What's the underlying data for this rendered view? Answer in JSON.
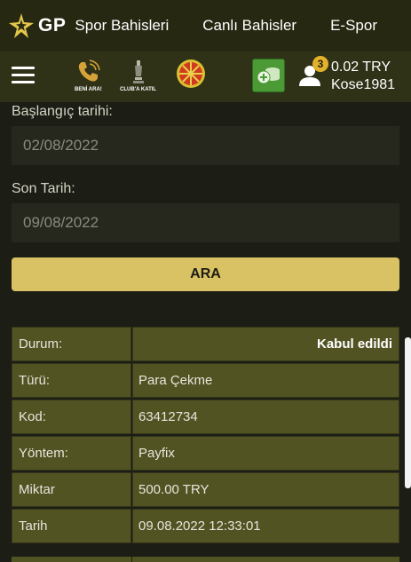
{
  "header": {
    "logo_text": "GP",
    "nav": [
      "Spor Bahisleri",
      "Canlı Bahisler",
      "E-Spor"
    ]
  },
  "toolbar": {
    "promos": [
      {
        "label": "BENİ ARA!",
        "icon": "phone-icon"
      },
      {
        "label": "CLUB'A KATIL",
        "icon": "trophy-icon"
      },
      {
        "label": "",
        "icon": "wheel-icon"
      }
    ],
    "notification_count": "3",
    "balance": "0.02 TRY",
    "username": "Kose1981"
  },
  "filters": {
    "start_label": "Başlangıç tarihi:",
    "start_value": "02/08/2022",
    "end_label": "Son Tarih:",
    "end_value": "09/08/2022",
    "search_label": "ARA"
  },
  "details": [
    {
      "key": "Durum:",
      "value": "Kabul edildi"
    },
    {
      "key": "Türü:",
      "value": "Para Çekme"
    },
    {
      "key": "Kod:",
      "value": "63412734"
    },
    {
      "key": "Yöntem:",
      "value": "Payfix"
    },
    {
      "key": "Miktar",
      "value": "500.00 TRY"
    },
    {
      "key": "Tarih",
      "value": "09.08.2022 12:33:01"
    }
  ],
  "colors": {
    "accent": "#d8c263",
    "table_cell": "#525323",
    "background": "#1c1d14",
    "cash_button": "#4c9a35",
    "badge": "#e3b22a"
  }
}
